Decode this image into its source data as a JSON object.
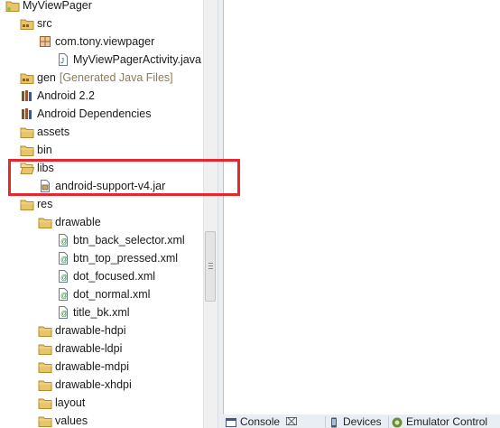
{
  "tree": [
    {
      "label": "MyViewPager",
      "icon": "project-icon",
      "name": "tree-item-myviewpager"
    },
    {
      "label": "src",
      "icon": "source-folder-icon",
      "name": "tree-item-src"
    },
    {
      "label": "com.tony.viewpager",
      "icon": "package-icon",
      "name": "tree-item-package"
    },
    {
      "label": "MyViewPagerActivity.java",
      "icon": "java-file-icon",
      "name": "tree-item-activity-java"
    },
    {
      "label": "gen",
      "suffix": "[Generated Java Files]",
      "icon": "source-folder-icon",
      "name": "tree-item-gen"
    },
    {
      "label": "Android 2.2",
      "icon": "library-icon",
      "name": "tree-item-android-22"
    },
    {
      "label": "Android Dependencies",
      "icon": "library-icon",
      "name": "tree-item-android-dependencies"
    },
    {
      "label": "assets",
      "icon": "folder-icon",
      "name": "tree-item-assets"
    },
    {
      "label": "bin",
      "icon": "folder-icon",
      "name": "tree-item-bin"
    },
    {
      "label": "libs",
      "icon": "folder-open-icon",
      "name": "tree-item-libs"
    },
    {
      "label": "android-support-v4.jar",
      "icon": "jar-file-icon",
      "name": "tree-item-support-jar"
    },
    {
      "label": "res",
      "icon": "folder-icon",
      "name": "tree-item-res"
    },
    {
      "label": "drawable",
      "icon": "folder-icon",
      "name": "tree-item-drawable"
    },
    {
      "label": "btn_back_selector.xml",
      "icon": "xml-file-icon",
      "name": "tree-item-btn-back-selector"
    },
    {
      "label": "btn_top_pressed.xml",
      "icon": "xml-file-icon",
      "name": "tree-item-btn-top-pressed"
    },
    {
      "label": "dot_focused.xml",
      "icon": "xml-file-icon",
      "name": "tree-item-dot-focused"
    },
    {
      "label": "dot_normal.xml",
      "icon": "xml-file-icon",
      "name": "tree-item-dot-normal"
    },
    {
      "label": "title_bk.xml",
      "icon": "xml-file-icon",
      "name": "tree-item-title-bk"
    },
    {
      "label": "drawable-hdpi",
      "icon": "folder-icon",
      "name": "tree-item-drawable-hdpi"
    },
    {
      "label": "drawable-ldpi",
      "icon": "folder-icon",
      "name": "tree-item-drawable-ldpi"
    },
    {
      "label": "drawable-mdpi",
      "icon": "folder-icon",
      "name": "tree-item-drawable-mdpi"
    },
    {
      "label": "drawable-xhdpi",
      "icon": "folder-icon",
      "name": "tree-item-drawable-xhdpi"
    },
    {
      "label": "layout",
      "icon": "folder-icon",
      "name": "tree-item-layout"
    },
    {
      "label": "values",
      "icon": "folder-icon",
      "name": "tree-item-values"
    }
  ],
  "bottom_tabs": [
    {
      "label": "Console",
      "close": "⌧",
      "icon": "console-icon",
      "name": "tab-console"
    },
    {
      "label": "Devices",
      "icon": "devices-icon",
      "name": "tab-devices"
    },
    {
      "label": "Emulator Control",
      "icon": "emulator-control-icon",
      "name": "tab-emulator-control"
    }
  ],
  "colors": {
    "highlight": "#e8262d",
    "folder": "#e8c46a",
    "generated_text": "#8a7d5a"
  }
}
